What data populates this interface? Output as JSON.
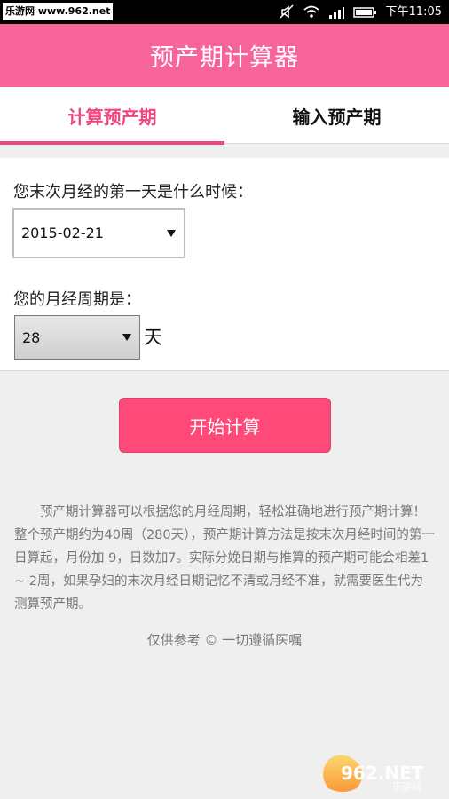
{
  "status_bar": {
    "site": "乐游网 www.962.net",
    "time": "下午11:05"
  },
  "app": {
    "title": "预产期计算器"
  },
  "tabs": [
    {
      "label": "计算预产期",
      "active": true
    },
    {
      "label": "输入预产期",
      "active": false
    }
  ],
  "form": {
    "last_period_label": "您末次月经的第一天是什么时候：",
    "last_period_value": "2015-02-21",
    "cycle_label": "您的月经周期是：",
    "cycle_value": "28",
    "cycle_unit": "天"
  },
  "actions": {
    "start_label": "开始计算"
  },
  "description": "预产期计算器可以根据您的月经周期，轻松准确地进行预产期计算！整个预产期约为40周（280天），预产期计算方法是按末次月经时间的第一日算起，月份加 9，日数加7。实际分娩日期与推算的预产期可能会相差1 ~ 2周，如果孕妇的末次月经日期记忆不清或月经不准，就需要医生代为测算预产期。",
  "footer": "仅供参考 © 一切遵循医嘱",
  "watermark": {
    "text": "962.NET",
    "subtext": "乐游网"
  },
  "colors": {
    "title_bg": "#f7649a",
    "active_tab": "#f0457e",
    "button_bg": "#ff4a79",
    "background": "#efefef"
  }
}
